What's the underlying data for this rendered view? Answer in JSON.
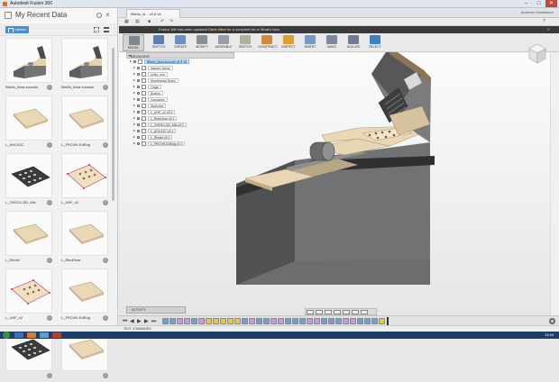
{
  "window": {
    "title": "Autodesk Fusion 360",
    "controls": [
      "–",
      "□",
      "✕"
    ]
  },
  "left_panel": {
    "title": "My Recent Data",
    "upload_label": "Upload",
    "items": [
      {
        "label": "Bitelio_biwa konsole",
        "kind": "model"
      },
      {
        "label": "Bitelio_biwa konsole",
        "kind": "model"
      },
      {
        "label": "L_AHC41C",
        "kind": "plate"
      },
      {
        "label": "L_FRCHH-EdEdg",
        "kind": "plate"
      },
      {
        "label": "L_OHDS-LSD_Mis",
        "kind": "pcb"
      },
      {
        "label": "L_UHF_v2",
        "kind": "panel"
      },
      {
        "label": "L_Riedel",
        "kind": "plate"
      },
      {
        "label": "L_RiedGear",
        "kind": "plate"
      },
      {
        "label": "L_UHF_v2",
        "kind": "panel"
      },
      {
        "label": "L_FRCHH-EdEdg",
        "kind": "plate"
      },
      {
        "label": "",
        "kind": "pcb"
      },
      {
        "label": "",
        "kind": "plate"
      }
    ]
  },
  "document_tab": {
    "label": "Bitelio_bi... v5.8 v8",
    "account": "Andreas Gustafsson"
  },
  "notice": {
    "text": "Fusion 360 has been updated!",
    "link": "Click Here",
    "rest": "for a complete list of What's New."
  },
  "ribbon": {
    "workspace": "MODEL",
    "groups": [
      {
        "label": "SKETCH",
        "color": "#5b7fb0"
      },
      {
        "label": "CREATE",
        "color": "#6a8fc4"
      },
      {
        "label": "MODIFY",
        "color": "#8a8f96"
      },
      {
        "label": "ASSEMBLE",
        "color": "#9a9da2"
      },
      {
        "label": "SKETCH",
        "color": "#a9b3a0"
      },
      {
        "label": "CONSTRUCT",
        "color": "#d08a3a"
      },
      {
        "label": "INSPECT",
        "color": "#e0a030"
      },
      {
        "label": "INSERT",
        "color": "#7898c8"
      },
      {
        "label": "MAKE",
        "color": "#7e8a96"
      },
      {
        "label": "ADD-INS",
        "color": "#6d7c90"
      },
      {
        "label": "SELECT",
        "color": "#3b80c8"
      }
    ]
  },
  "browser": {
    "title": "BROWSER",
    "rows": [
      {
        "text": "Bitelio_biwa konsole v5.8 v8",
        "level": 0,
        "type": "root"
      },
      {
        "text": "Named Views",
        "level": 1,
        "type": "folder"
      },
      {
        "text": "Units: mm",
        "level": 1,
        "type": "folder"
      },
      {
        "text": "Sheetmetal Rules",
        "level": 1,
        "type": "folder"
      },
      {
        "text": "Origin",
        "level": 1,
        "type": "folder"
      },
      {
        "text": "Bodies",
        "level": 1,
        "type": "folder"
      },
      {
        "text": "Canvases",
        "level": 1,
        "type": "folder"
      },
      {
        "text": "Sketches",
        "level": 1,
        "type": "folder"
      },
      {
        "text": "L_UHF_v2 v2:1",
        "level": 1,
        "type": "comp"
      },
      {
        "text": "L_RiedGear v2:1",
        "level": 1,
        "type": "comp"
      },
      {
        "text": "L_OHDS-LSD_Mis v2:1",
        "level": 1,
        "type": "comp"
      },
      {
        "text": "L_AHC41C v2:1",
        "level": 1,
        "type": "comp"
      },
      {
        "text": "L_Riedel v2:1",
        "level": 1,
        "type": "comp"
      },
      {
        "text": "L_FRCHH-EdEdg v2:1",
        "level": 1,
        "type": "comp"
      }
    ]
  },
  "activity": {
    "label": "ACTIVITY"
  },
  "text_commands": {
    "label": "TEXT COMMANDS"
  },
  "timeline_features": [
    "#6ea0d8",
    "#6ea0d8",
    "#c79ae0",
    "#c79ae0",
    "#6ea0d8",
    "#c79ae0",
    "#e3c84a",
    "#e3c84a",
    "#e3c84a",
    "#e3c84a",
    "#e3c84a",
    "#6ea0d8",
    "#c79ae0",
    "#6ea0d8",
    "#6ea0d8",
    "#c79ae0",
    "#c79ae0",
    "#6ea0d8",
    "#6ea0d8",
    "#6ea0d8",
    "#c79ae0",
    "#c79ae0",
    "#6ea0d8",
    "#6ea0d8",
    "#6ea0d8",
    "#c79ae0",
    "#c79ae0",
    "#6ea0d8",
    "#6ea0d8",
    "#6ea0d8",
    "#e3c84a"
  ],
  "taskbar": {
    "apps": [
      "#3a6fbf",
      "#e07b25",
      "#5aa0d8",
      "#c03a2b"
    ],
    "clock": "13:54"
  },
  "colors": {
    "accent": "#4a8ed1",
    "wood": "#e7d4b2",
    "body_front": "#6a6b6b",
    "body_side": "#4e4f50",
    "notice_bg": "#3a3a3a"
  }
}
